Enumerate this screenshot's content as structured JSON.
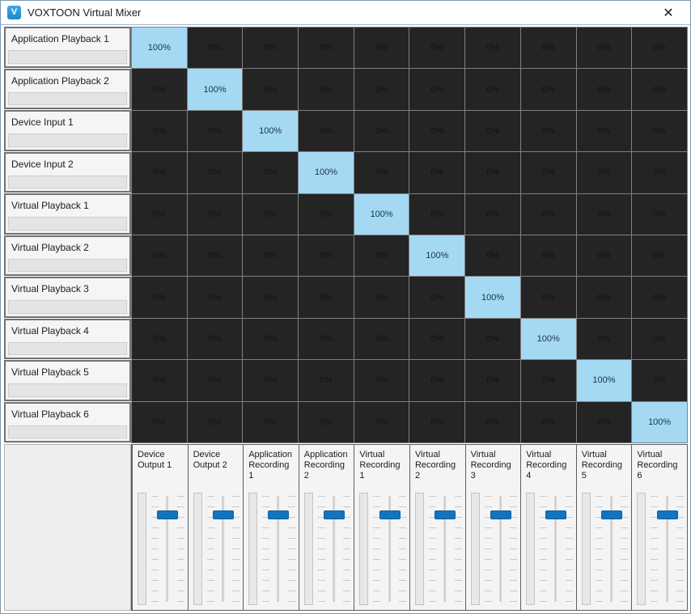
{
  "window": {
    "title": "VOXTOON Virtual Mixer",
    "icon": "app-icon-v",
    "icon_letter": "V",
    "close_label": "✕",
    "accent_color": "#1473be",
    "cell_on_color": "#a5d8f3",
    "cell_off_color": "#242424"
  },
  "matrix": {
    "row_labels": [
      "Application Playback 1",
      "Application Playback 2",
      "Device Input 1",
      "Device Input 2",
      "Virtual Playback 1",
      "Virtual Playback 2",
      "Virtual Playback 3",
      "Virtual Playback 4",
      "Virtual Playback 5",
      "Virtual Playback 6"
    ],
    "column_labels": [
      "Device Output 1",
      "Device Output 2",
      "Application Recording 1",
      "Application Recording 2",
      "Virtual Recording 1",
      "Virtual Recording 2",
      "Virtual Recording 3",
      "Virtual Recording 4",
      "Virtual Recording 5",
      "Virtual Recording 6"
    ],
    "on_value": "100%",
    "off_value": "0%",
    "values": [
      [
        "100%",
        "0%",
        "0%",
        "0%",
        "0%",
        "0%",
        "0%",
        "0%",
        "0%",
        "0%"
      ],
      [
        "0%",
        "100%",
        "0%",
        "0%",
        "0%",
        "0%",
        "0%",
        "0%",
        "0%",
        "0%"
      ],
      [
        "0%",
        "0%",
        "100%",
        "0%",
        "0%",
        "0%",
        "0%",
        "0%",
        "0%",
        "0%"
      ],
      [
        "0%",
        "0%",
        "0%",
        "100%",
        "0%",
        "0%",
        "0%",
        "0%",
        "0%",
        "0%"
      ],
      [
        "0%",
        "0%",
        "0%",
        "0%",
        "100%",
        "0%",
        "0%",
        "0%",
        "0%",
        "0%"
      ],
      [
        "0%",
        "0%",
        "0%",
        "0%",
        "0%",
        "100%",
        "0%",
        "0%",
        "0%",
        "0%"
      ],
      [
        "0%",
        "0%",
        "0%",
        "0%",
        "0%",
        "0%",
        "100%",
        "0%",
        "0%",
        "0%"
      ],
      [
        "0%",
        "0%",
        "0%",
        "0%",
        "0%",
        "0%",
        "0%",
        "100%",
        "0%",
        "0%"
      ],
      [
        "0%",
        "0%",
        "0%",
        "0%",
        "0%",
        "0%",
        "0%",
        "0%",
        "100%",
        "0%"
      ],
      [
        "0%",
        "0%",
        "0%",
        "0%",
        "0%",
        "0%",
        "0%",
        "0%",
        "0%",
        "100%"
      ]
    ]
  },
  "faders": {
    "positions_pct": [
      16,
      16,
      16,
      16,
      16,
      16,
      16,
      16,
      16,
      16
    ],
    "tick_count": 11
  }
}
